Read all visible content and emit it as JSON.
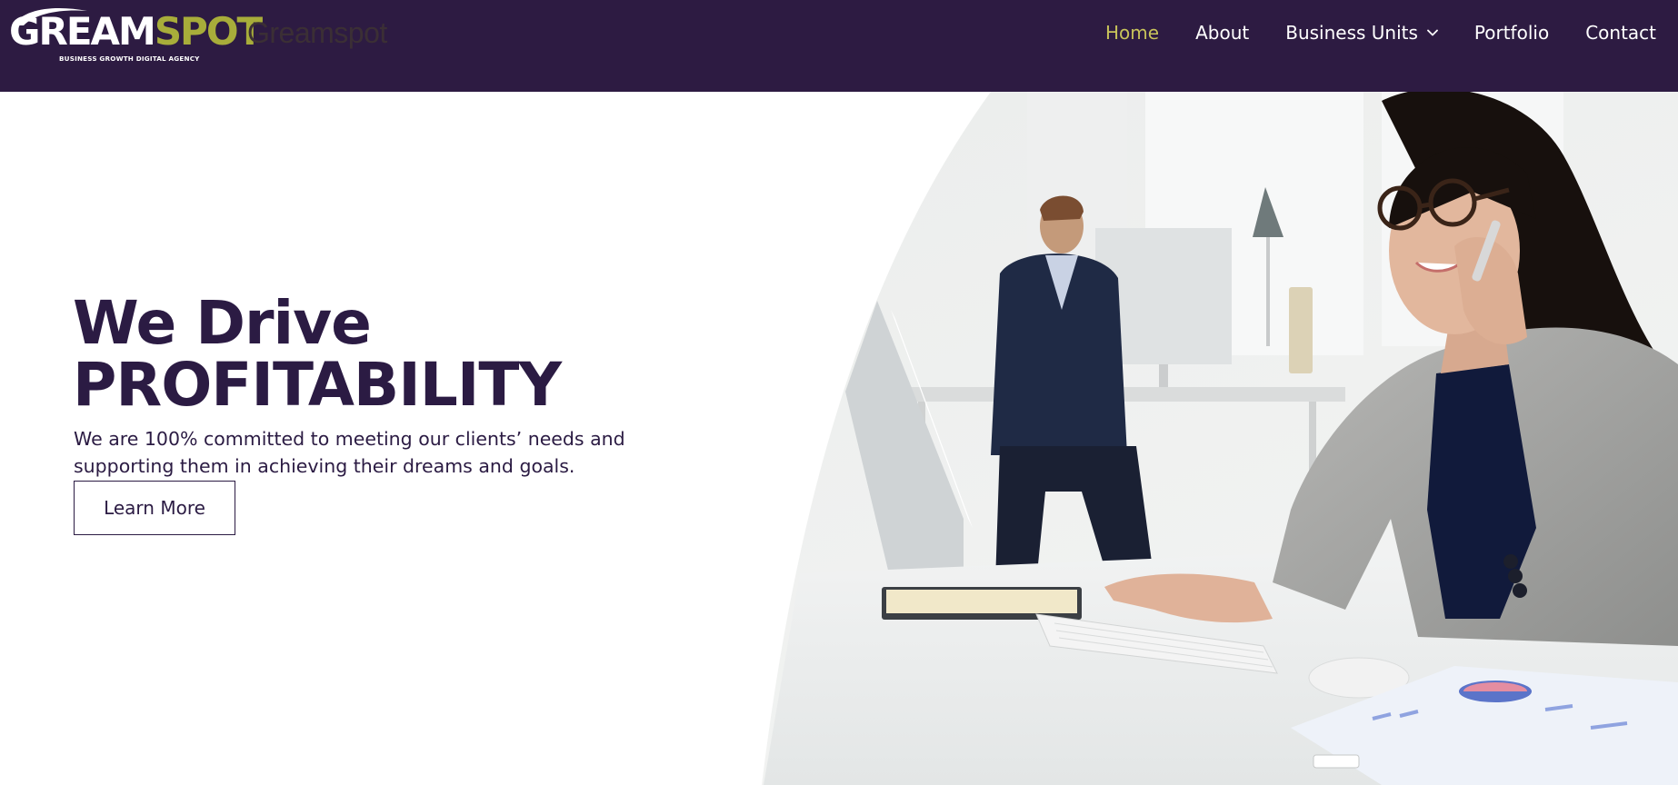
{
  "brand": {
    "logo_word_white": "GREAM",
    "logo_word_yellow": "SPOT",
    "tagline": "BUSINESS GROWTH DIGITAL AGENCY",
    "site_title": "Greamspot"
  },
  "nav": {
    "items": [
      {
        "label": "Home",
        "active": true
      },
      {
        "label": "About"
      },
      {
        "label": "Business Units",
        "dropdown": true
      },
      {
        "label": "Portfolio"
      },
      {
        "label": "Contact"
      }
    ]
  },
  "hero": {
    "headline_line1": "We Drive",
    "headline_line2": "PROFITABILITY",
    "subtext": "We are 100% committed to meeting our clients’ needs and supporting them in achieving their dreams and goals.",
    "cta_label": "Learn More"
  },
  "colors": {
    "header_bg": "#2d1b42",
    "accent": "#c8c35a",
    "text_dark": "#2b1b43"
  }
}
